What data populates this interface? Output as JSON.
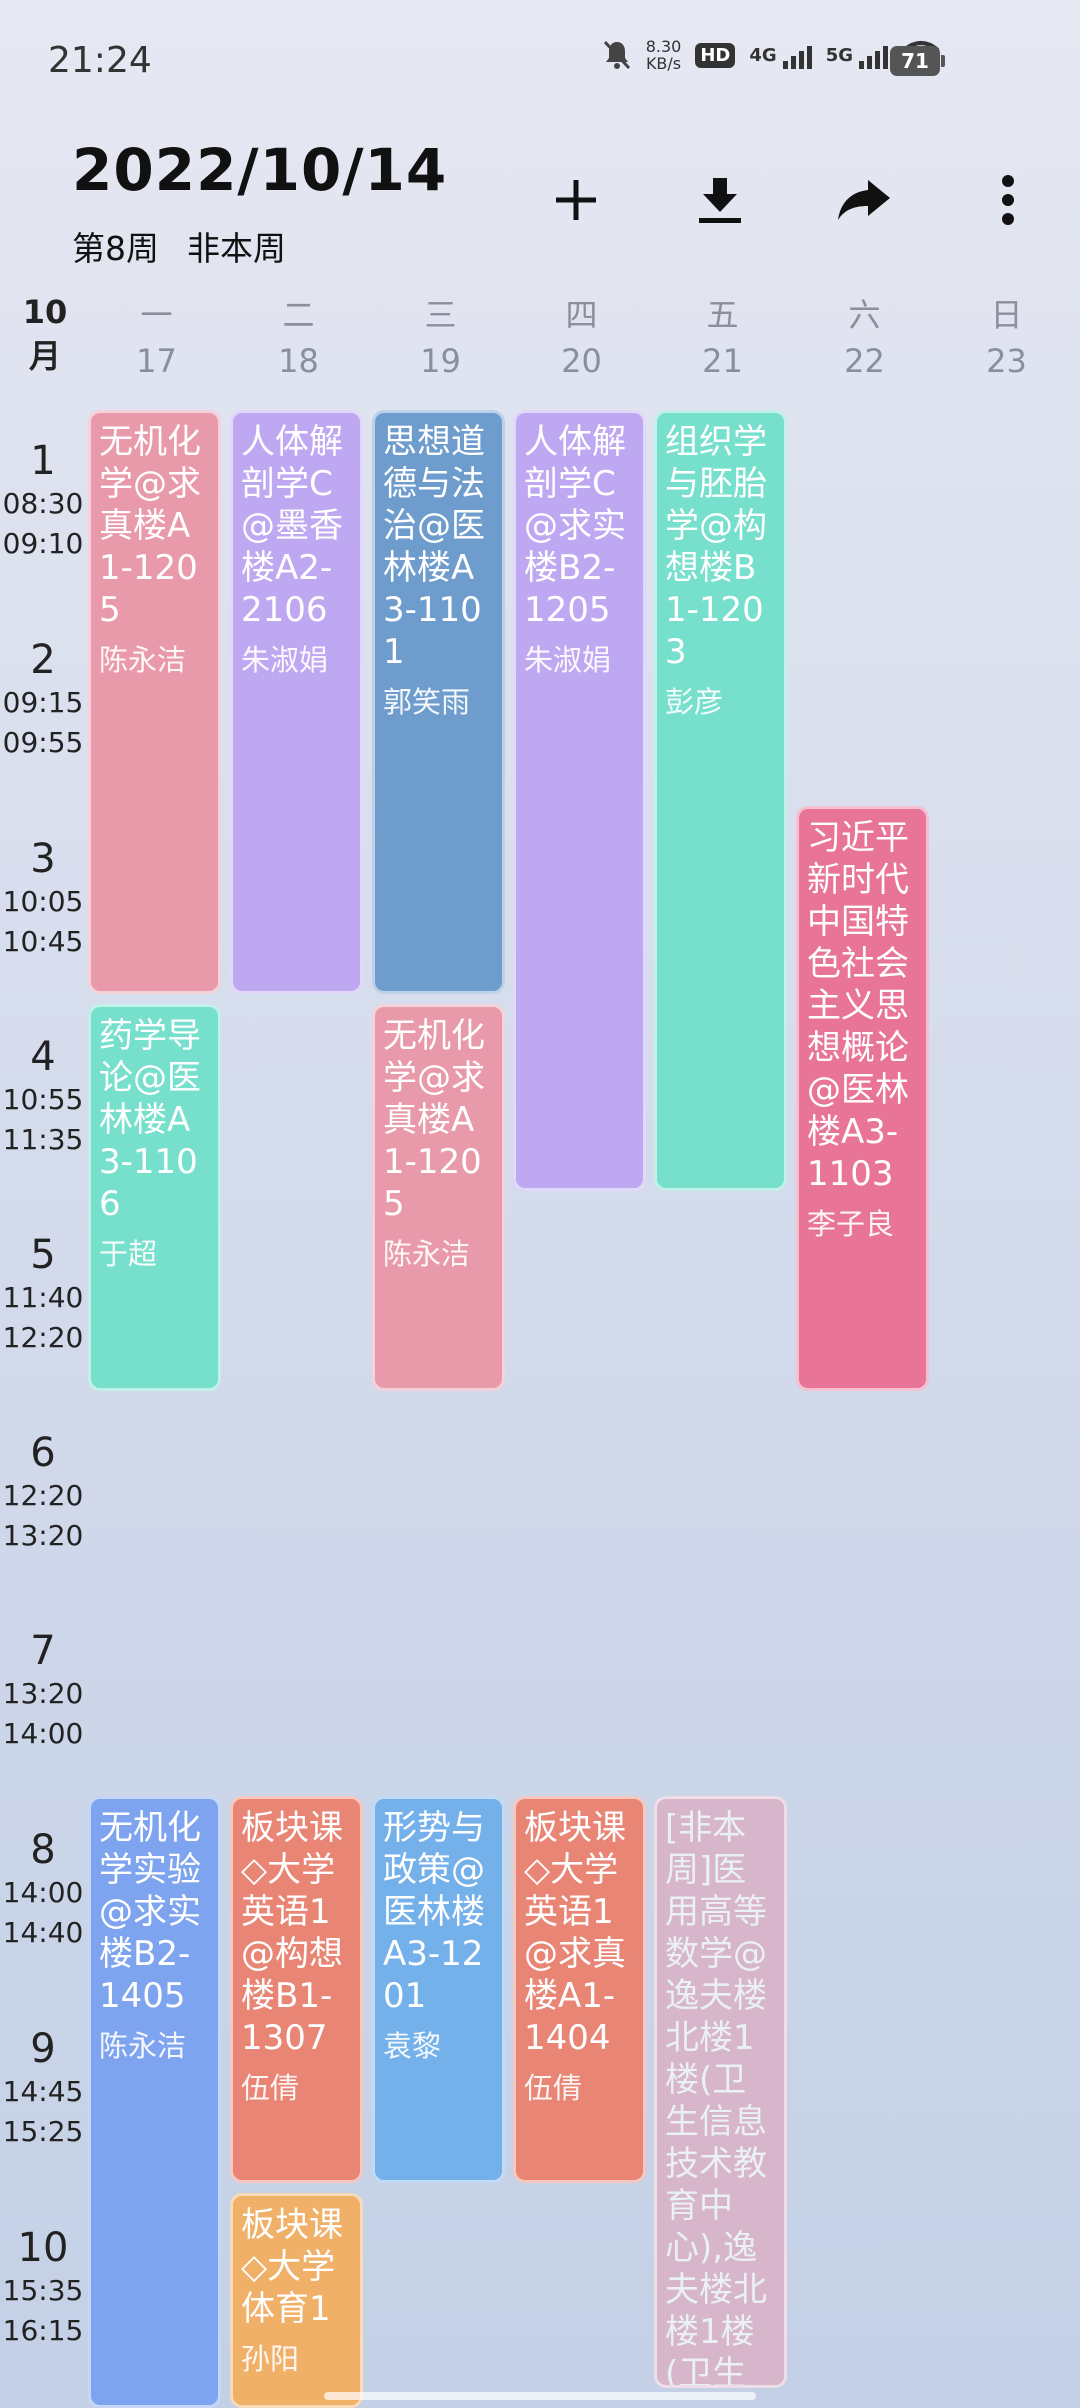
{
  "status_bar": {
    "time": "21:24",
    "net_speed_value": "8.30",
    "net_speed_unit": "KB/s",
    "hd_label": "HD",
    "sig1_label": "4G",
    "sig2_label": "5G",
    "battery": "71"
  },
  "header": {
    "date": "2022/10/14",
    "week_num": "第8周",
    "week_status": "非本周",
    "icons": [
      "add-icon",
      "download-icon",
      "share-icon",
      "more-icon"
    ]
  },
  "month_label": {
    "num": "10",
    "unit": "月"
  },
  "days": [
    {
      "name": "一",
      "date": "17"
    },
    {
      "name": "二",
      "date": "18"
    },
    {
      "name": "三",
      "date": "19"
    },
    {
      "name": "四",
      "date": "20"
    },
    {
      "name": "五",
      "date": "21"
    },
    {
      "name": "六",
      "date": "22"
    },
    {
      "name": "日",
      "date": "23"
    }
  ],
  "periods": [
    {
      "num": "1",
      "start": "08:30",
      "end": "09:10"
    },
    {
      "num": "2",
      "start": "09:15",
      "end": "09:55"
    },
    {
      "num": "3",
      "start": "10:05",
      "end": "10:45"
    },
    {
      "num": "4",
      "start": "10:55",
      "end": "11:35"
    },
    {
      "num": "5",
      "start": "11:40",
      "end": "12:20"
    },
    {
      "num": "6",
      "start": "12:20",
      "end": "13:20"
    },
    {
      "num": "7",
      "start": "13:20",
      "end": "14:00"
    },
    {
      "num": "8",
      "start": "14:00",
      "end": "14:40"
    },
    {
      "num": "9",
      "start": "14:45",
      "end": "15:25"
    },
    {
      "num": "10",
      "start": "15:35",
      "end": "16:15"
    }
  ],
  "courses": [
    {
      "name": "无机化学@求真楼A1-1205",
      "teacher": "陈永洁",
      "color": "#e99aaa"
    },
    {
      "name": "人体解剖学C@墨香楼A2-2106",
      "teacher": "朱淑娟",
      "color": "#bfa8f2"
    },
    {
      "name": "思想道德与法治@医林楼A3-1101",
      "teacher": "郭笑雨",
      "color": "#6e9ccd"
    },
    {
      "name": "人体解剖学C@求实楼B2-1205",
      "teacher": "朱淑娟",
      "color": "#bfa8f2"
    },
    {
      "name": "组织学与胚胎学@构想楼B1-1203",
      "teacher": "彭彦",
      "color": "#77e0cc"
    },
    {
      "name": "习近平新时代中国特色社会主义思想概论@医林楼A3-1103",
      "teacher": "李子良",
      "color": "#e87498"
    },
    {
      "name": "药学导论@医林楼A3-1106",
      "teacher": "于超",
      "color": "#77e0cc"
    },
    {
      "name": "无机化学@求真楼A1-1205",
      "teacher": "陈永洁",
      "color": "#e99aaa"
    },
    {
      "name": "无机化学实验@求实楼B2-1405",
      "teacher": "陈永洁",
      "color": "#7ea4ef"
    },
    {
      "name": "板块课◇大学英语1@构想楼B1-1307",
      "teacher": "伍倩",
      "color": "#e98574"
    },
    {
      "name": "形势与政策@医林楼A3-1201",
      "teacher": "袁黎",
      "color": "#74b0ea"
    },
    {
      "name": "板块课◇大学英语1@求真楼A1-1404",
      "teacher": "伍倩",
      "color": "#e98574"
    },
    {
      "name": "[非本周]医用高等数学@逸夫楼北楼1楼(卫生信息技术教育中心),逸夫楼北楼1楼(卫生",
      "teacher": "",
      "color": "#d7b6cc"
    },
    {
      "name": "板块课◇大学体育1",
      "teacher": "孙阳",
      "color": "#f0b068"
    }
  ]
}
